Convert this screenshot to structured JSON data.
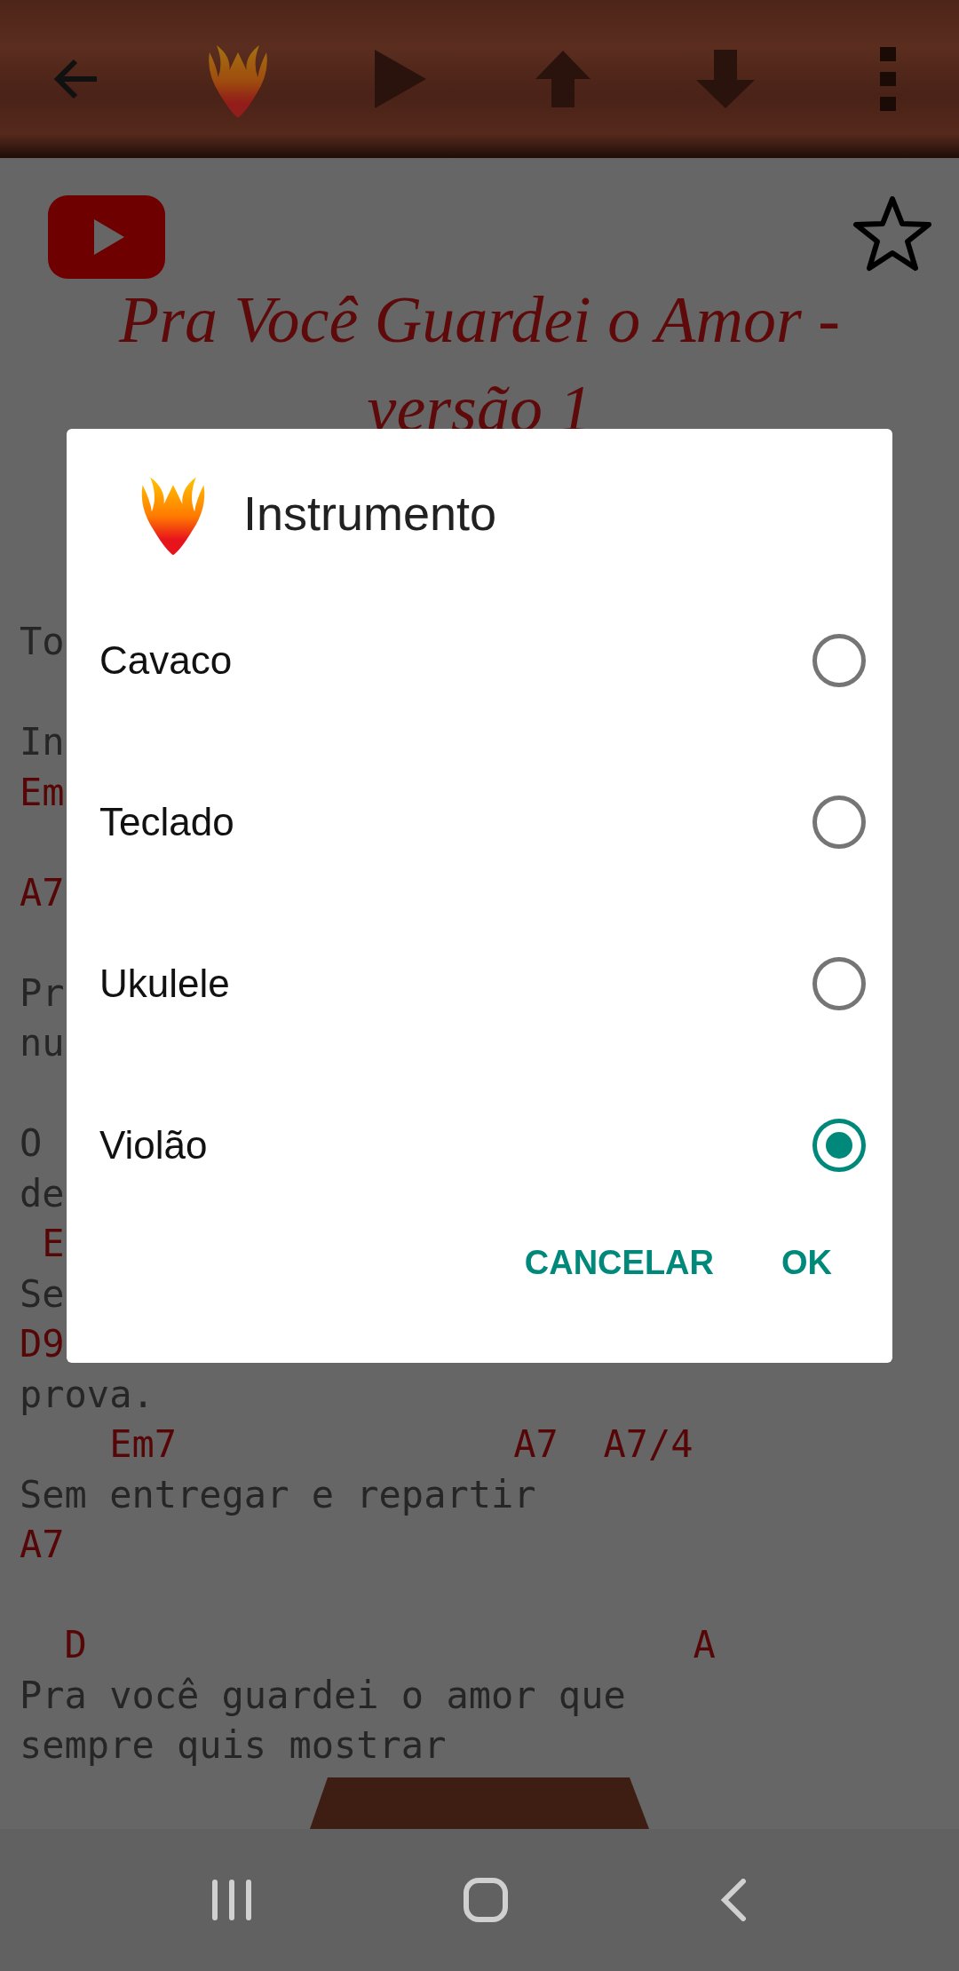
{
  "song": {
    "favorite": false,
    "title_lines": [
      "Pra Você Guardei o Amor -",
      "versão 1"
    ],
    "lines": [
      {
        "kind": "text",
        "text": "To"
      },
      {
        "kind": "blank"
      },
      {
        "kind": "text",
        "text": "In"
      },
      {
        "kind": "chord",
        "text": "Em"
      },
      {
        "kind": "blank"
      },
      {
        "kind": "chord",
        "text": "A7"
      },
      {
        "kind": "blank"
      },
      {
        "kind": "text",
        "text": "Pr"
      },
      {
        "kind": "text",
        "text": "nu"
      },
      {
        "kind": "blank"
      },
      {
        "kind": "text",
        "text": "O"
      },
      {
        "kind": "text",
        "text": "de"
      },
      {
        "kind": "chord",
        "text": " E"
      },
      {
        "kind": "text",
        "text": "Se"
      },
      {
        "kind": "chord",
        "text": "D9"
      },
      {
        "kind": "text",
        "text": "prova."
      },
      {
        "kind": "chord",
        "text": "    Em7               A7  A7/4"
      },
      {
        "kind": "text",
        "text": "Sem entregar e repartir"
      },
      {
        "kind": "chord",
        "text": "A7"
      },
      {
        "kind": "blank"
      },
      {
        "kind": "chord",
        "text": "  D                           A"
      },
      {
        "kind": "text",
        "text": "Pra você guardei o amor que"
      },
      {
        "kind": "text",
        "text": "sempre quis mostrar"
      }
    ]
  },
  "dialog": {
    "title": "Instrumento",
    "options": [
      {
        "label": "Cavaco",
        "selected": false
      },
      {
        "label": "Teclado",
        "selected": false
      },
      {
        "label": "Ukulele",
        "selected": false
      },
      {
        "label": "Violão",
        "selected": true
      }
    ],
    "buttons": [
      "CANCELAR",
      "OK"
    ]
  }
}
